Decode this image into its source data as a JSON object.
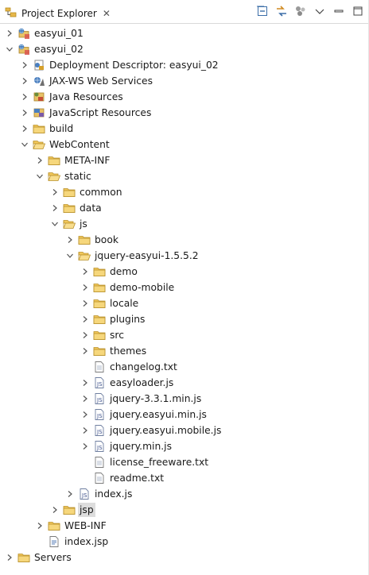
{
  "view": {
    "title": "Project Explorer",
    "close_symbol": "✕",
    "toolbar_icons": [
      "collapse-all-icon",
      "link-with-editor-icon",
      "filters-icon",
      "view-menu-icon",
      "minimize-icon",
      "maximize-icon"
    ]
  },
  "tree": [
    {
      "label": "easyui_01",
      "depth": 0,
      "expanded": false,
      "twisty": true,
      "icon": "web-project-icon"
    },
    {
      "label": "easyui_02",
      "depth": 0,
      "expanded": true,
      "twisty": true,
      "icon": "web-project-icon"
    },
    {
      "label": "Deployment Descriptor: easyui_02",
      "depth": 1,
      "expanded": false,
      "twisty": true,
      "icon": "deployment-descriptor-icon"
    },
    {
      "label": "JAX-WS Web Services",
      "depth": 1,
      "expanded": false,
      "twisty": true,
      "icon": "web-services-icon"
    },
    {
      "label": "Java Resources",
      "depth": 1,
      "expanded": false,
      "twisty": true,
      "icon": "java-resources-icon"
    },
    {
      "label": "JavaScript Resources",
      "depth": 1,
      "expanded": false,
      "twisty": true,
      "icon": "javascript-resources-icon"
    },
    {
      "label": "build",
      "depth": 1,
      "expanded": false,
      "twisty": true,
      "icon": "folder-icon"
    },
    {
      "label": "WebContent",
      "depth": 1,
      "expanded": true,
      "twisty": true,
      "icon": "folder-open-icon"
    },
    {
      "label": "META-INF",
      "depth": 2,
      "expanded": false,
      "twisty": true,
      "icon": "folder-icon"
    },
    {
      "label": "static",
      "depth": 2,
      "expanded": true,
      "twisty": true,
      "icon": "folder-open-icon"
    },
    {
      "label": "common",
      "depth": 3,
      "expanded": false,
      "twisty": true,
      "icon": "folder-icon"
    },
    {
      "label": "data",
      "depth": 3,
      "expanded": false,
      "twisty": true,
      "icon": "folder-icon"
    },
    {
      "label": "js",
      "depth": 3,
      "expanded": true,
      "twisty": true,
      "icon": "folder-open-icon"
    },
    {
      "label": "book",
      "depth": 4,
      "expanded": false,
      "twisty": true,
      "icon": "folder-icon"
    },
    {
      "label": "jquery-easyui-1.5.5.2",
      "depth": 4,
      "expanded": true,
      "twisty": true,
      "icon": "folder-open-icon"
    },
    {
      "label": "demo",
      "depth": 5,
      "expanded": false,
      "twisty": true,
      "icon": "folder-icon"
    },
    {
      "label": "demo-mobile",
      "depth": 5,
      "expanded": false,
      "twisty": true,
      "icon": "folder-icon"
    },
    {
      "label": "locale",
      "depth": 5,
      "expanded": false,
      "twisty": true,
      "icon": "folder-icon"
    },
    {
      "label": "plugins",
      "depth": 5,
      "expanded": false,
      "twisty": true,
      "icon": "folder-icon"
    },
    {
      "label": "src",
      "depth": 5,
      "expanded": false,
      "twisty": true,
      "icon": "folder-icon"
    },
    {
      "label": "themes",
      "depth": 5,
      "expanded": false,
      "twisty": true,
      "icon": "folder-icon"
    },
    {
      "label": "changelog.txt",
      "depth": 5,
      "expanded": false,
      "twisty": false,
      "icon": "text-file-icon"
    },
    {
      "label": "easyloader.js",
      "depth": 5,
      "expanded": false,
      "twisty": true,
      "icon": "js-file-icon"
    },
    {
      "label": "jquery-3.3.1.min.js",
      "depth": 5,
      "expanded": false,
      "twisty": true,
      "icon": "js-file-icon"
    },
    {
      "label": "jquery.easyui.min.js",
      "depth": 5,
      "expanded": false,
      "twisty": true,
      "icon": "js-file-icon"
    },
    {
      "label": "jquery.easyui.mobile.js",
      "depth": 5,
      "expanded": false,
      "twisty": true,
      "icon": "js-file-icon"
    },
    {
      "label": "jquery.min.js",
      "depth": 5,
      "expanded": false,
      "twisty": true,
      "icon": "js-file-icon"
    },
    {
      "label": "license_freeware.txt",
      "depth": 5,
      "expanded": false,
      "twisty": false,
      "icon": "text-file-icon"
    },
    {
      "label": "readme.txt",
      "depth": 5,
      "expanded": false,
      "twisty": false,
      "icon": "text-file-icon"
    },
    {
      "label": "index.js",
      "depth": 4,
      "expanded": false,
      "twisty": true,
      "icon": "js-file-icon"
    },
    {
      "label": "jsp",
      "depth": 3,
      "expanded": false,
      "twisty": true,
      "icon": "folder-icon",
      "selected": true
    },
    {
      "label": "WEB-INF",
      "depth": 2,
      "expanded": false,
      "twisty": true,
      "icon": "folder-icon"
    },
    {
      "label": "index.jsp",
      "depth": 2,
      "expanded": false,
      "twisty": false,
      "icon": "jsp-file-icon"
    },
    {
      "label": "Servers",
      "depth": 0,
      "expanded": false,
      "twisty": true,
      "icon": "folder-icon"
    }
  ]
}
